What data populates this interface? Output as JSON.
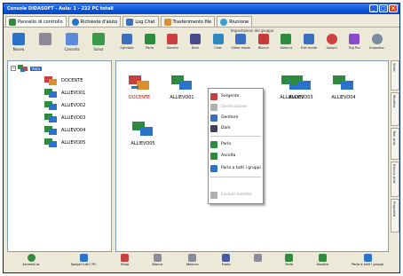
{
  "window": {
    "title": "Console DIDASOFT - Aula: 1 - 222 PC totali"
  },
  "tabs": [
    {
      "label": "Pannello di controllo",
      "color": "#2e8b3e"
    },
    {
      "label": "Richieste d'aiuto",
      "color": "#2a73c8"
    },
    {
      "label": "Log Chat",
      "color": "#3a6fc0"
    },
    {
      "label": "Trasferimento file",
      "color": "#d89030"
    },
    {
      "label": "Riunione",
      "color": "#3aa0d0"
    }
  ],
  "left_toolbar": [
    {
      "label": "Nuovo",
      "color": "#2a73c8"
    },
    {
      "label": "",
      "color": "#8a8a9a"
    },
    {
      "label": "Cancella",
      "color": "#5a8ad8"
    },
    {
      "label": "Salva",
      "color": "#3a9a4a"
    }
  ],
  "group_header": "Impostazioni del gruppo",
  "right_toolbar": [
    {
      "label": "Sgridato",
      "color": "#3a6fc0"
    },
    {
      "label": "Parla",
      "color": "#2e8b3e"
    },
    {
      "label": "Ascolta",
      "color": "#c84040"
    },
    {
      "label": "Dark",
      "color": "#4a4a8a"
    },
    {
      "label": "Chat",
      "color": "#2a8ac0"
    },
    {
      "label": "Video mode",
      "color": "#3a6fc0"
    },
    {
      "label": "Blocca",
      "color": "#c83a3a"
    },
    {
      "label": "Sblocca",
      "color": "#2e8b3e"
    },
    {
      "label": "Exit mode",
      "color": "#3a6fc0"
    },
    {
      "label": "Spegni",
      "color": "#d04040"
    },
    {
      "label": "Tag Pro",
      "color": "#8a4ad0"
    },
    {
      "label": "Impostaz.",
      "color": "#7a8aa0"
    }
  ],
  "tree": {
    "root_label": "Aula",
    "items": [
      "DOCENTE",
      "ALLIEVO01",
      "ALLIEVO02",
      "ALLIEVO03",
      "ALLIEVO04",
      "ALLIEVO05"
    ]
  },
  "main": {
    "computers": [
      {
        "label": "DOCENTE",
        "teacher": true
      },
      {
        "label": "ALLIEVO01"
      },
      {
        "label": "ALLIEVO02"
      },
      {
        "label": "ALLIEVO03"
      },
      {
        "label": "ALLIEVO04"
      },
      {
        "label": "ALLIEVO05"
      }
    ]
  },
  "context_menu": [
    {
      "label": "Sorgente",
      "disabled": false,
      "color": "#c84040"
    },
    {
      "label": "Destinazione",
      "disabled": true,
      "color": "#b0b0b0"
    },
    {
      "label": "Genitore",
      "disabled": false,
      "color": "#3a6fc0"
    },
    {
      "label": "Dark",
      "disabled": false,
      "color": "#404060"
    },
    {
      "label": "Parla",
      "disabled": false,
      "color": "#2e8b3e"
    },
    {
      "label": "Ascolta",
      "disabled": false,
      "color": "#2e8b3e"
    },
    {
      "label": "Parla a tutti i gruppi",
      "disabled": false,
      "color": "#2a73c8"
    },
    {
      "label": "Escludi monitor",
      "disabled": true,
      "color": "#b0b0b0"
    }
  ],
  "side_tabs": [
    "Sinte",
    "Monitor",
    "Tool prof.",
    "Blocco prof.",
    "Proprietà"
  ],
  "bottom_left": [
    {
      "label": "Accendi pc",
      "color": "#2e8b3e"
    },
    {
      "label": "Spegni tutti i PC",
      "color": "#2a73c8"
    }
  ],
  "bottom_main": [
    {
      "label": "Drag",
      "color": "#c84040"
    },
    {
      "label": "Blocca",
      "color": "#8a8a9a"
    },
    {
      "label": "Sblocca",
      "color": "#8a8a9a"
    },
    {
      "label": "Esplo",
      "color": "#4a5aa0"
    },
    {
      "label": "",
      "color": "#8a8a9a"
    },
    {
      "label": "Parla",
      "color": "#2e8b3e"
    },
    {
      "label": "Ascolta",
      "color": "#2e8b3e"
    },
    {
      "label": "Parla a tutti i gruppi",
      "color": "#2a73c8"
    }
  ]
}
